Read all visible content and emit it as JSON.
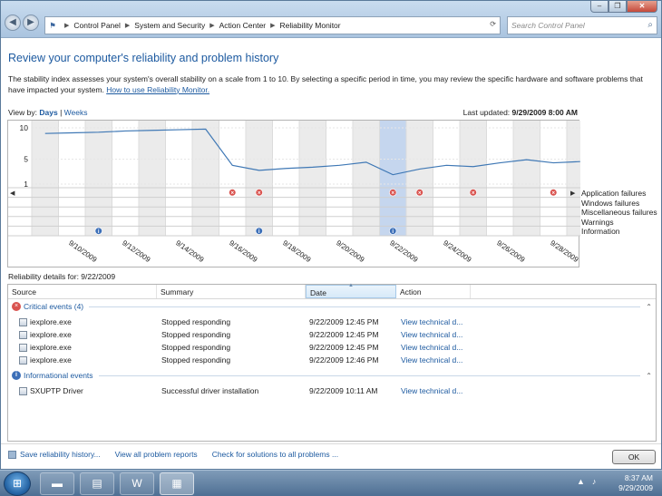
{
  "window": {
    "breadcrumbs": [
      "Control Panel",
      "System and Security",
      "Action Center",
      "Reliability Monitor"
    ],
    "search_placeholder": "Search Control Panel",
    "minimize": "–",
    "maximize": "❐",
    "close": "✕"
  },
  "page": {
    "heading": "Review your computer's reliability and problem history",
    "description": "The stability index assesses your system's overall stability on a scale from 1 to 10. By selecting a specific period in time, you may review the specific hardware and software problems that have impacted your system.",
    "help_link": "How to use Reliability Monitor.",
    "view_by_label": "View by:",
    "view_days": "Days",
    "view_sep": "|",
    "view_weeks": "Weeks",
    "last_updated_label": "Last updated:",
    "last_updated_value": "9/29/2009 8:00 AM",
    "details_label": "Reliability details for: 9/22/2009"
  },
  "chart_data": {
    "type": "line",
    "title": "",
    "ylim": [
      1,
      10
    ],
    "yticks": [
      "10",
      "5",
      "1"
    ],
    "dates": [
      "9/9/2009",
      "9/10/2009",
      "9/11/2009",
      "9/12/2009",
      "9/13/2009",
      "9/14/2009",
      "9/15/2009",
      "9/16/2009",
      "9/17/2009",
      "9/18/2009",
      "9/19/2009",
      "9/20/2009",
      "9/21/2009",
      "9/22/2009",
      "9/23/2009",
      "9/24/2009",
      "9/25/2009",
      "9/26/2009",
      "9/27/2009",
      "9/28/2009",
      "9/29/2009"
    ],
    "x_tick_labels": [
      "9/10/2009",
      "9/12/2009",
      "9/14/2009",
      "9/16/2009",
      "9/18/2009",
      "9/20/2009",
      "9/22/2009",
      "9/24/2009",
      "9/26/2009",
      "9/28/2009"
    ],
    "stability_index": [
      9.1,
      9.2,
      9.3,
      9.5,
      9.6,
      9.7,
      9.8,
      4.0,
      3.2,
      3.5,
      3.7,
      4.0,
      4.5,
      2.5,
      3.4,
      4.0,
      3.8,
      4.4,
      4.9,
      4.4,
      4.6
    ],
    "selected_date": "9/22/2009",
    "event_rows": [
      "Application failures",
      "Windows failures",
      "Miscellaneous failures",
      "Warnings",
      "Information"
    ],
    "events": [
      {
        "date": "9/16/2009",
        "row": "Application failures",
        "kind": "error"
      },
      {
        "date": "9/17/2009",
        "row": "Application failures",
        "kind": "error"
      },
      {
        "date": "9/22/2009",
        "row": "Application failures",
        "kind": "error"
      },
      {
        "date": "9/23/2009",
        "row": "Application failures",
        "kind": "error"
      },
      {
        "date": "9/25/2009",
        "row": "Application failures",
        "kind": "error"
      },
      {
        "date": "9/28/2009",
        "row": "Application failures",
        "kind": "error"
      },
      {
        "date": "9/11/2009",
        "row": "Information",
        "kind": "info"
      },
      {
        "date": "9/17/2009",
        "row": "Information",
        "kind": "info"
      },
      {
        "date": "9/22/2009",
        "row": "Information",
        "kind": "info"
      }
    ]
  },
  "table": {
    "columns": [
      "Source",
      "Summary",
      "Date",
      "Action"
    ],
    "groups": [
      {
        "title": "Critical events (4)",
        "rows": [
          {
            "source": "iexplore.exe",
            "summary": "Stopped responding",
            "date": "9/22/2009 12:45 PM",
            "action": "View  technical d..."
          },
          {
            "source": "iexplore.exe",
            "summary": "Stopped responding",
            "date": "9/22/2009 12:45 PM",
            "action": "View  technical d..."
          },
          {
            "source": "iexplore.exe",
            "summary": "Stopped responding",
            "date": "9/22/2009 12:45 PM",
            "action": "View  technical d..."
          },
          {
            "source": "iexplore.exe",
            "summary": "Stopped responding",
            "date": "9/22/2009 12:46 PM",
            "action": "View  technical d..."
          }
        ]
      },
      {
        "title": "Informational events",
        "rows": [
          {
            "source": "SXUPTP Driver",
            "summary": "Successful driver installation",
            "date": "9/22/2009 10:11 AM",
            "action": "View  technical d..."
          }
        ]
      }
    ]
  },
  "footer": {
    "save_history": "Save reliability history...",
    "view_all": "View all problem reports",
    "check_solutions": "Check for solutions to all problems ...",
    "ok": "OK"
  },
  "taskbar": {
    "time": "8:37 AM",
    "date": "9/29/2009"
  },
  "colors": {
    "accent": "#1d5aa0",
    "line": "#3f78b5",
    "selected_column": "#c5d6ee",
    "shaded_column": "#ebebeb",
    "error": "#d9534f",
    "info": "#3c6fb8"
  }
}
